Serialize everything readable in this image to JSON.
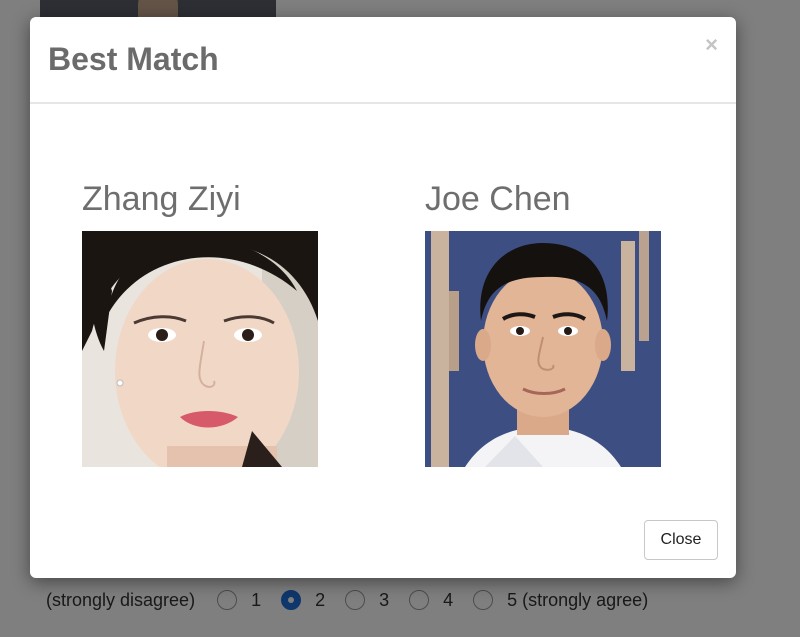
{
  "modal": {
    "title": "Best Match",
    "close_icon": "×",
    "close_button_label": "Close",
    "matches": [
      {
        "name": "Zhang Ziyi"
      },
      {
        "name": "Joe Chen"
      }
    ]
  },
  "rating": {
    "anchor_left": "(strongly disagree)",
    "options": [
      "1",
      "2",
      "3",
      "4",
      "5 (strongly agree)"
    ],
    "selected": "2"
  },
  "colors": {
    "backdrop": "#000000",
    "accent": "#1e6fd9"
  }
}
